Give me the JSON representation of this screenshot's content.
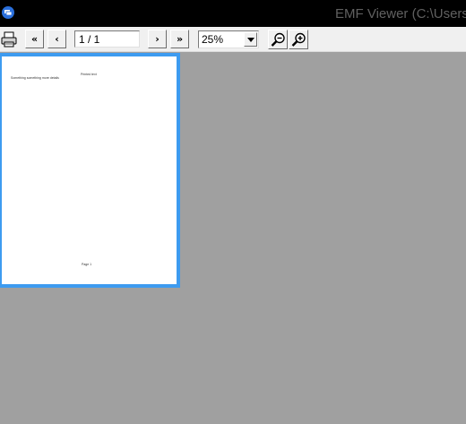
{
  "window": {
    "title": "EMF Viewer (C:\\Users\\",
    "app_icon": "emf-viewer-app-icon"
  },
  "toolbar": {
    "print_icon": "printer-icon",
    "first_label": "«",
    "prev_label": "‹",
    "page_value": "1 / 1",
    "next_label": "›",
    "last_label": "»",
    "zoom_value": "25%",
    "zoom_out_icon": "zoom-out-icon",
    "zoom_in_icon": "zoom-in-icon"
  },
  "document_page": {
    "header_text": "Printed text",
    "body_text": "Something something more details",
    "footer_text": "Page 1"
  },
  "colors": {
    "titlebar": "#000000",
    "toolbar": "#f0f0f0",
    "viewport": "#a0a0a0",
    "selection_border": "#3d9bf0",
    "page": "#ffffff"
  }
}
